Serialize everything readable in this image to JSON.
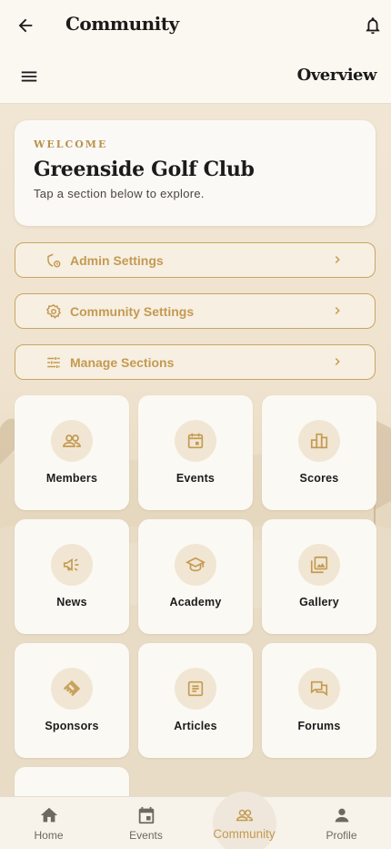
{
  "header": {
    "title": "Community",
    "subtitle": "Overview"
  },
  "welcome": {
    "label": "WELCOME",
    "club_name": "Greenside Golf Club",
    "hint": "Tap a section below to explore."
  },
  "actions": [
    {
      "label": "Admin Settings",
      "icon": "admin-settings-icon"
    },
    {
      "label": "Community Settings",
      "icon": "gear-icon"
    },
    {
      "label": "Manage Sections",
      "icon": "sliders-icon"
    }
  ],
  "tiles": [
    {
      "label": "Members",
      "icon": "members-icon"
    },
    {
      "label": "Events",
      "icon": "calendar-icon"
    },
    {
      "label": "Scores",
      "icon": "leaderboard-icon"
    },
    {
      "label": "News",
      "icon": "megaphone-icon"
    },
    {
      "label": "Academy",
      "icon": "graduation-cap-icon"
    },
    {
      "label": "Gallery",
      "icon": "gallery-icon"
    },
    {
      "label": "Sponsors",
      "icon": "handshake-icon"
    },
    {
      "label": "Articles",
      "icon": "article-icon"
    },
    {
      "label": "Forums",
      "icon": "forum-icon"
    }
  ],
  "nav": [
    {
      "label": "Home",
      "icon": "home-icon",
      "active": false
    },
    {
      "label": "Events",
      "icon": "calendar-icon",
      "active": false
    },
    {
      "label": "Community",
      "icon": "community-icon",
      "active": true
    },
    {
      "label": "Profile",
      "icon": "person-icon",
      "active": false
    }
  ],
  "colors": {
    "accent": "#c49a52",
    "background": "#f5ede0",
    "card": "#fbf9f4"
  }
}
